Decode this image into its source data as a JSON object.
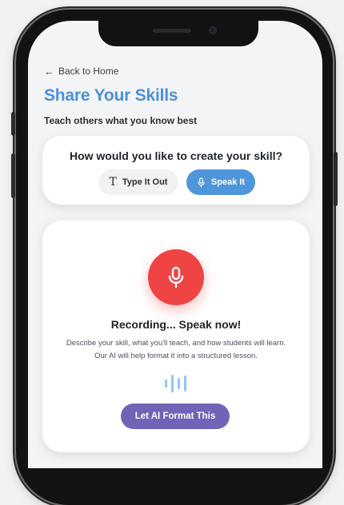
{
  "nav": {
    "back_arrow": "←",
    "back_label": "Back to Home"
  },
  "header": {
    "title": "Share Your Skills",
    "subtitle": "Teach others what you know best"
  },
  "mode_card": {
    "question": "How would you like to create your skill?",
    "options": [
      {
        "label": "Type It Out",
        "icon": "text-t-icon",
        "selected": false
      },
      {
        "label": "Speak It",
        "icon": "microphone-icon",
        "selected": true
      }
    ]
  },
  "recording_card": {
    "icon": "microphone-icon",
    "title": "Recording... Speak now!",
    "description": "Describe your skill, what you'll teach, and how students will learn. Our AI will help format it into a structured lesson.",
    "wave_icon": "audio-wave-icon",
    "action_label": "Let AI Format This"
  },
  "colors": {
    "accent_blue": "#4a90d9",
    "speak_button": "#4f95da",
    "record_red": "#ef4444",
    "ai_button_purple": "#7163b6",
    "wave_blue": "#93c5fd"
  }
}
